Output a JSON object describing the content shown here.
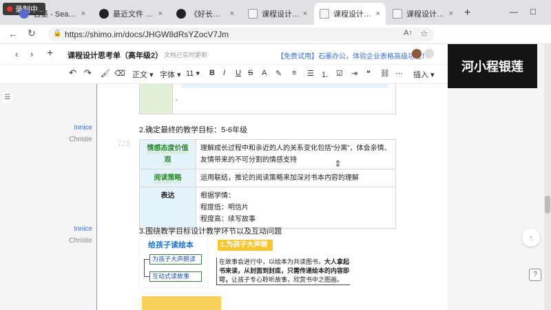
{
  "recording": {
    "label": "录制中..."
  },
  "tabs": [
    {
      "label": "石墨 - Search",
      "color": "#5a6acf"
    },
    {
      "label": "最近文件 - 石墨文档",
      "color": "#222222"
    },
    {
      "label": "《好长好长的蛇》",
      "color": "#222222"
    },
    {
      "label": "课程设计思考单（高",
      "color": "#f4f4f4"
    },
    {
      "label": "课程设计思考单（高",
      "color": "#f4f4f4"
    },
    {
      "label": "课程设计思考单（高",
      "color": "#f4f4f4"
    }
  ],
  "tab_new": "+",
  "window_controls": {
    "min": "—",
    "max": "□"
  },
  "address": {
    "url": "https://shimo.im/docs/JHGW8dRsYZocV7Jm"
  },
  "header": {
    "doc_title": "课程设计思考单（高年级2）",
    "save_status": "文档已实时更新",
    "promo": "【免费试用】石墨办公，体验企业表格高级功能！",
    "new_label": "+"
  },
  "toolbar": {
    "style": "正文",
    "font": "字体",
    "size": "11",
    "insert": "插入",
    "bold": "B",
    "italic": "I",
    "underline": "U",
    "strike": "S"
  },
  "overlay_name": "河小程银莲",
  "comments": [
    {
      "author": "Innice",
      "sub": "Christie"
    },
    {
      "author": "Innice",
      "sub": "Christie"
    }
  ],
  "doc": {
    "section2_title": "2.确定最终的教学目标：5-6年级",
    "goals_table": [
      {
        "header": "情感态度价值观",
        "content": "理解成长过程中和亲近的人的关系变化包括“分离”，体会亲情、友情带来的不可分割的情感支持"
      },
      {
        "header": "阅读策略",
        "content": "运用联结，推论的阅读策略来加深对书本内容的理解"
      },
      {
        "header": "表达",
        "content_lines": [
          "根据学情：",
          "程度低：明信片",
          "程度高：续写故事"
        ]
      }
    ],
    "section3_title": "3.围绕教学目标设计教学环节以及互动问题",
    "diagram": {
      "title": "给孩子读绘本",
      "step1": "为孩子大声朗读",
      "step2": "互动式读故事",
      "callout_title": "1.为孩子大声朗读",
      "callout_text_a": "在故事会进行中，以绘本为共读图书，",
      "callout_text_bold": "大人拿起书来读，从封面到封底，只需传递绘本的内容即可，",
      "callout_text_b": "让孩子专心聆听故事，欣赏书中之图画。"
    }
  },
  "colors": {
    "accent": "#3d6bd6",
    "header_cell": "#e4f2fa",
    "callout": "#f7c531",
    "diagram_title": "#1a73c8"
  }
}
